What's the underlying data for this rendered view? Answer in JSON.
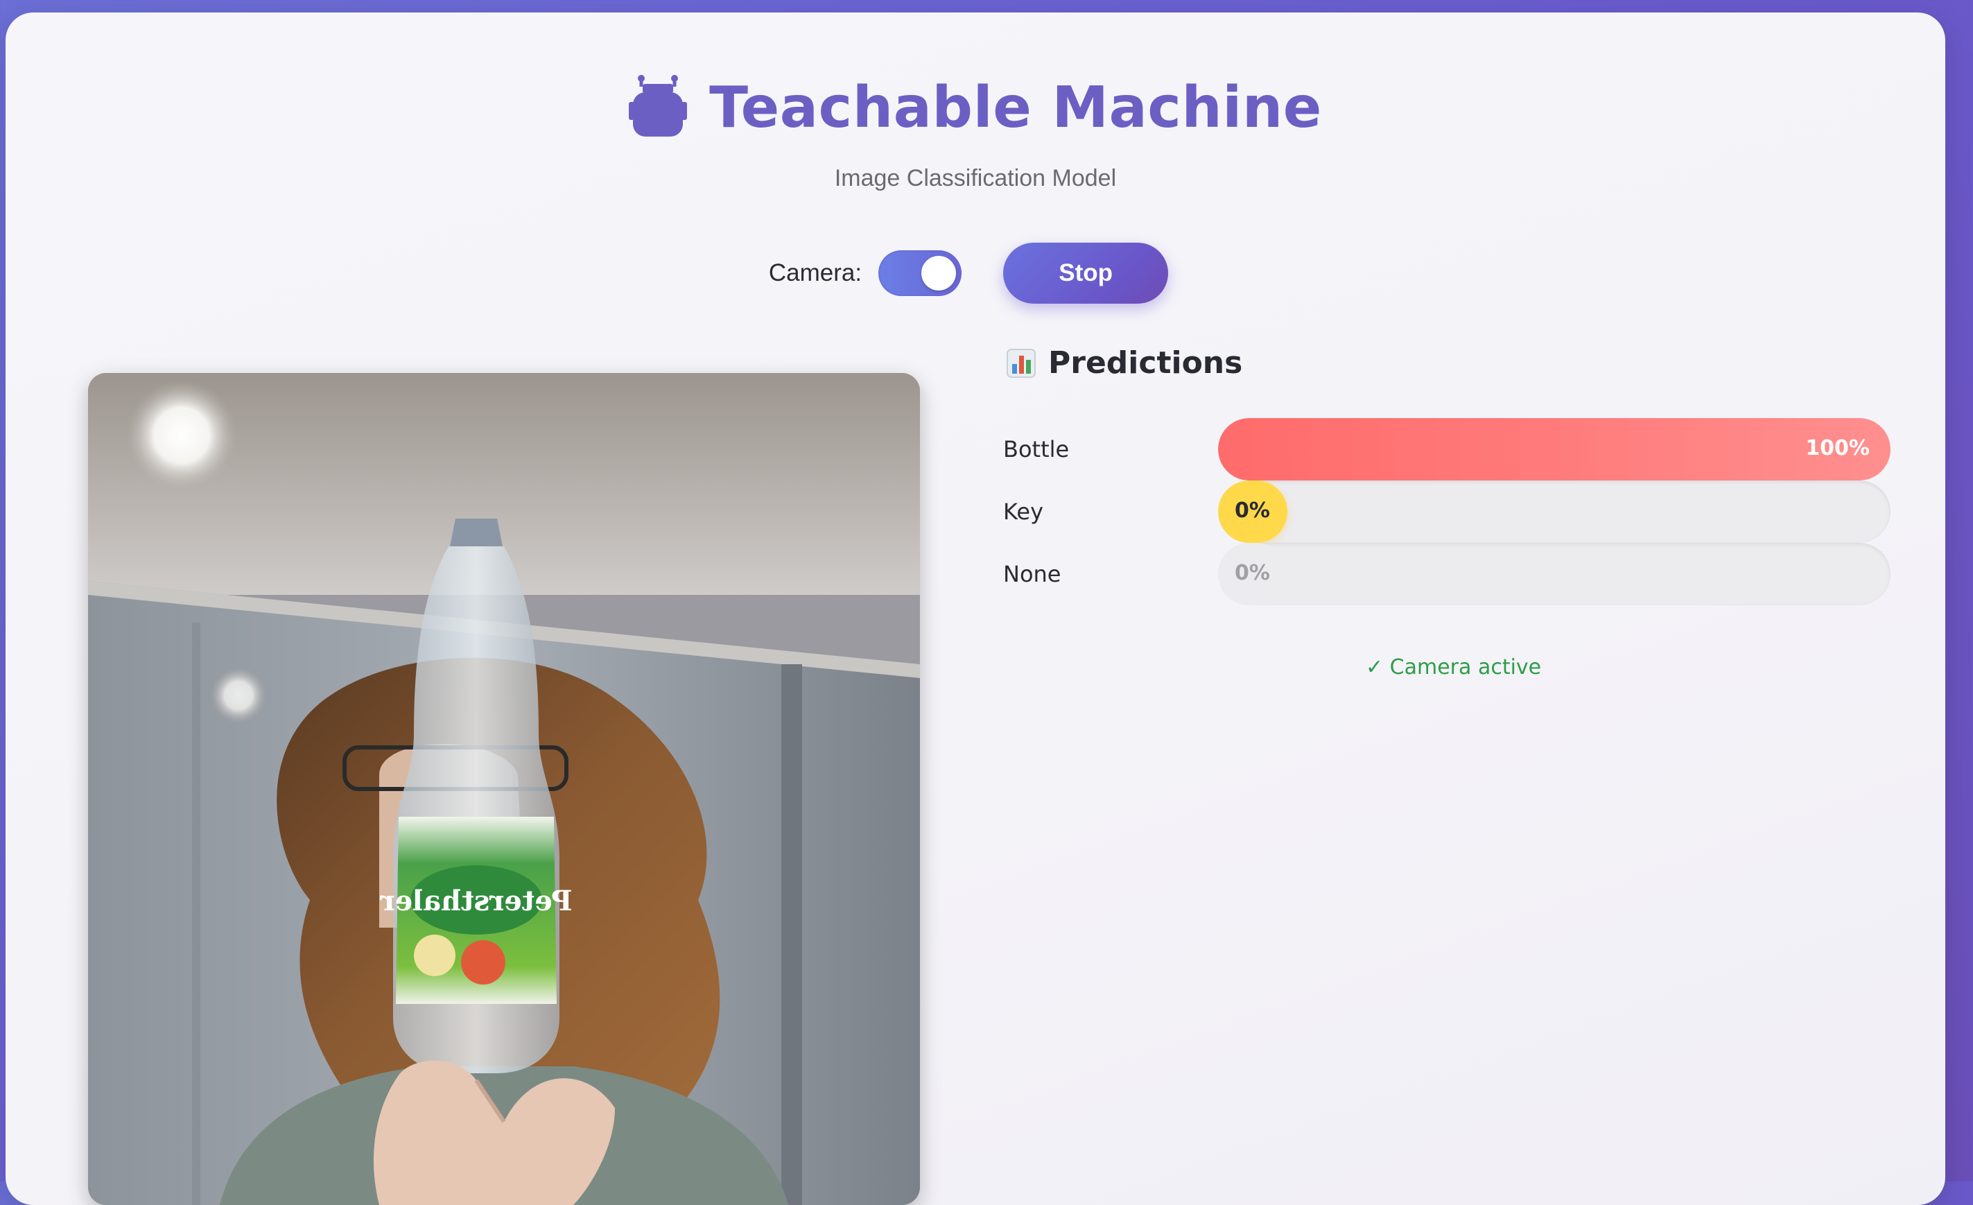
{
  "app": {
    "title": "Teachable Machine",
    "subtitle": "Image Classification Model",
    "logo_icon": "robot-icon"
  },
  "controls": {
    "camera_label": "Camera:",
    "camera_on": true,
    "stop_label": "Stop"
  },
  "predictions": {
    "heading": "Predictions",
    "heading_icon": "bar-chart-icon",
    "items": [
      {
        "label": "Bottle",
        "percent_text": "100%",
        "value": 1.0,
        "color": "#ff6b6b",
        "text_color": "#ffffff"
      },
      {
        "label": "Key",
        "percent_text": "0%",
        "value": 0.0,
        "color": "#ffd94a",
        "text_color": "#2a2a33"
      },
      {
        "label": "None",
        "percent_text": "0%",
        "value": 0.0,
        "color": "#ecebee",
        "text_color": "#a0a0a6"
      }
    ]
  },
  "status": {
    "text": "✓ Camera active",
    "color": "#2e9d48"
  },
  "colors": {
    "accent": "#6b5fc4",
    "background": "#6a5ccf"
  }
}
